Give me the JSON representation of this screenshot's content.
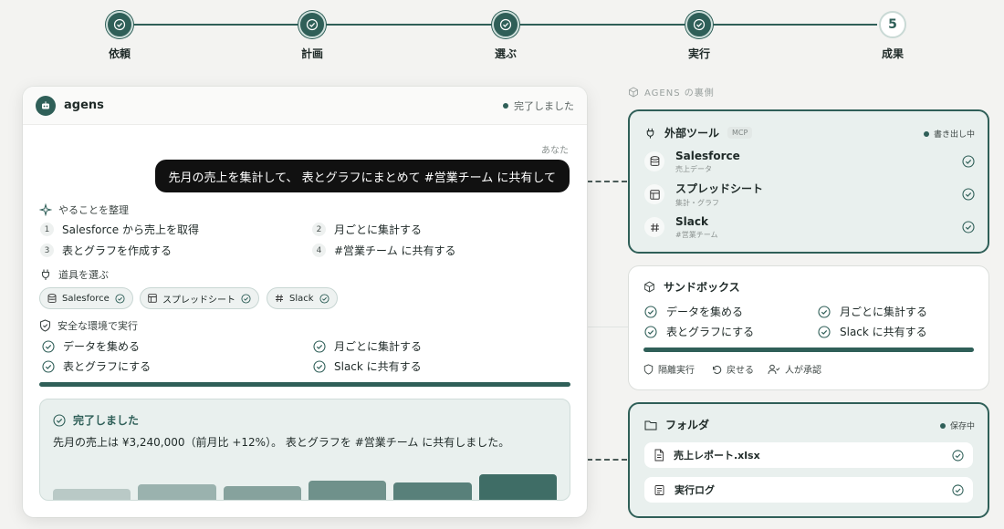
{
  "stepper": {
    "steps": [
      {
        "label": "依頼",
        "state": "done"
      },
      {
        "label": "計画",
        "state": "done"
      },
      {
        "label": "選ぶ",
        "state": "done"
      },
      {
        "label": "実行",
        "state": "done"
      },
      {
        "label": "成果",
        "state": "current",
        "number": "5"
      }
    ]
  },
  "chat": {
    "app_name": "agens",
    "status": "完了しました",
    "you_label": "あなた",
    "user_message": "先月の売上を集計して、 表とグラフにまとめて #営業チーム に共有して",
    "plan": {
      "title": "やることを整理",
      "tasks": [
        {
          "num": "1",
          "text": "Salesforce から売上を取得"
        },
        {
          "num": "2",
          "text": "月ごとに集計する"
        },
        {
          "num": "3",
          "text": "表とグラフを作成する"
        },
        {
          "num": "4",
          "text": "#営業チーム に共有する"
        }
      ]
    },
    "tools": {
      "title": "道具を選ぶ",
      "chips": [
        "Salesforce",
        "スプレッドシート",
        "Slack"
      ]
    },
    "execute": {
      "title": "安全な環境で実行",
      "items": [
        "データを集める",
        "月ごとに集計する",
        "表とグラフにする",
        "Slack に共有する"
      ],
      "progress": 1.0
    },
    "result": {
      "title": "完了しました",
      "text": "先月の売上は ¥3,240,000（前月比 +12%）。 表とグラフを #営業チーム に共有しました。",
      "mini_bars": [
        0.38,
        0.52,
        0.46,
        0.66,
        0.6,
        0.86
      ]
    }
  },
  "backside": {
    "label": "AGENS の裏側",
    "external_tools": {
      "title": "外部ツール",
      "tag": "MCP",
      "status": "書き出し中",
      "tools": [
        {
          "name": "Salesforce",
          "sub": "売上データ"
        },
        {
          "name": "スプレッドシート",
          "sub": "集計・グラフ"
        },
        {
          "name": "Slack",
          "sub": "#営業チーム"
        }
      ]
    },
    "sandbox": {
      "title": "サンドボックス",
      "items": [
        "データを集める",
        "月ごとに集計する",
        "表とグラフにする",
        "Slack に共有する"
      ],
      "progress": 1.0,
      "footer": [
        "隔離実行",
        "戻せる",
        "人が承認"
      ]
    },
    "folder": {
      "title": "フォルダ",
      "status": "保存中",
      "files": [
        "売上レポート.xlsx",
        "実行ログ"
      ]
    }
  },
  "colors": {
    "accent": "#2f5f58",
    "accent_light": "#e9f0ee",
    "bubble": "#111111"
  }
}
